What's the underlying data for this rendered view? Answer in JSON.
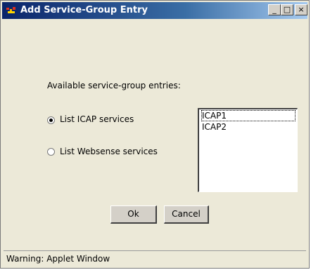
{
  "window": {
    "title": "Add Service-Group Entry"
  },
  "titlebar": {
    "minimize_glyph": "_",
    "maximize_glyph": "□",
    "close_glyph": "×"
  },
  "dialog": {
    "prompt": "Available service-group entries:",
    "options": [
      {
        "label": "List ICAP services",
        "selected": true
      },
      {
        "label": "List Websense services",
        "selected": false
      }
    ],
    "list_items": [
      "ICAP1",
      "ICAP2"
    ],
    "ok_label": "Ok",
    "cancel_label": "Cancel"
  },
  "statusbar": {
    "text": "Warning: Applet Window"
  },
  "icons": [
    "java-coffee-icon",
    "minimize-icon",
    "maximize-icon",
    "close-icon"
  ],
  "colors": {
    "titlebar_start": "#0a246a",
    "titlebar_end": "#a6caf0",
    "background": "#ece9d8"
  }
}
